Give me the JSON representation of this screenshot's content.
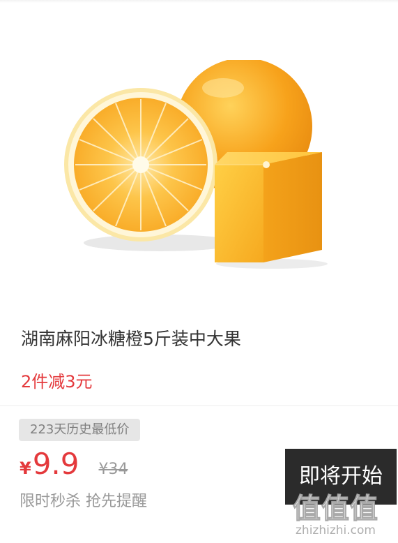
{
  "product": {
    "title": "湖南麻阳冰糖橙5斤装中大果",
    "promo": "2件减3元",
    "image_alt": "oranges"
  },
  "pricing": {
    "history_badge": "223天历史最低价",
    "currency": "¥",
    "price": "9.9",
    "original_price": "¥34",
    "flash_note": "限时秒杀 抢先提醒"
  },
  "action": {
    "start_label": "即将开始"
  },
  "watermark": {
    "logo": "值值值",
    "url": "zhizhizhi.com"
  },
  "colors": {
    "accent": "#e4393c",
    "button_bg": "#2b2b2b",
    "orange_peel": "#f6a318",
    "orange_flesh": "#fbb936"
  }
}
